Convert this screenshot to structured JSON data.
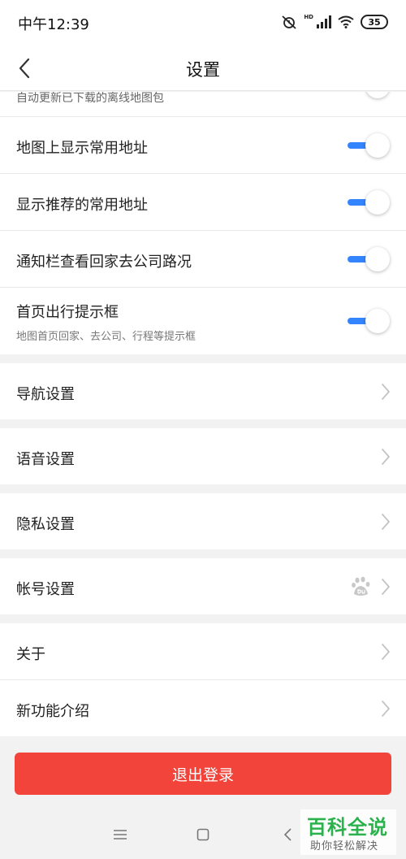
{
  "status_bar": {
    "time": "中午12:39",
    "battery": "35",
    "hd": "HD"
  },
  "header": {
    "title": "设置"
  },
  "partial_item": {
    "text": "自动更新已下载的离线地图包"
  },
  "toggle_items": [
    {
      "label": "地图上显示常用地址",
      "enabled": true
    },
    {
      "label": "显示推荐的常用地址",
      "enabled": true
    },
    {
      "label": "通知栏查看回家去公司路况",
      "enabled": true
    },
    {
      "label": "首页出行提示框",
      "subtitle": "地图首页回家、去公司、行程等提示框",
      "enabled": true
    }
  ],
  "menu_items": [
    {
      "label": "导航设置"
    },
    {
      "label": "语音设置"
    },
    {
      "label": "隐私设置"
    },
    {
      "label": "帐号设置"
    },
    {
      "label": "关于"
    },
    {
      "label": "新功能介绍"
    }
  ],
  "logout": {
    "label": "退出登录"
  },
  "watermark": {
    "main": "百科全说",
    "sub": "助你轻松解决"
  },
  "colors": {
    "accent": "#3385ff",
    "danger": "#f2443a",
    "watermark": "#2bb24c"
  }
}
